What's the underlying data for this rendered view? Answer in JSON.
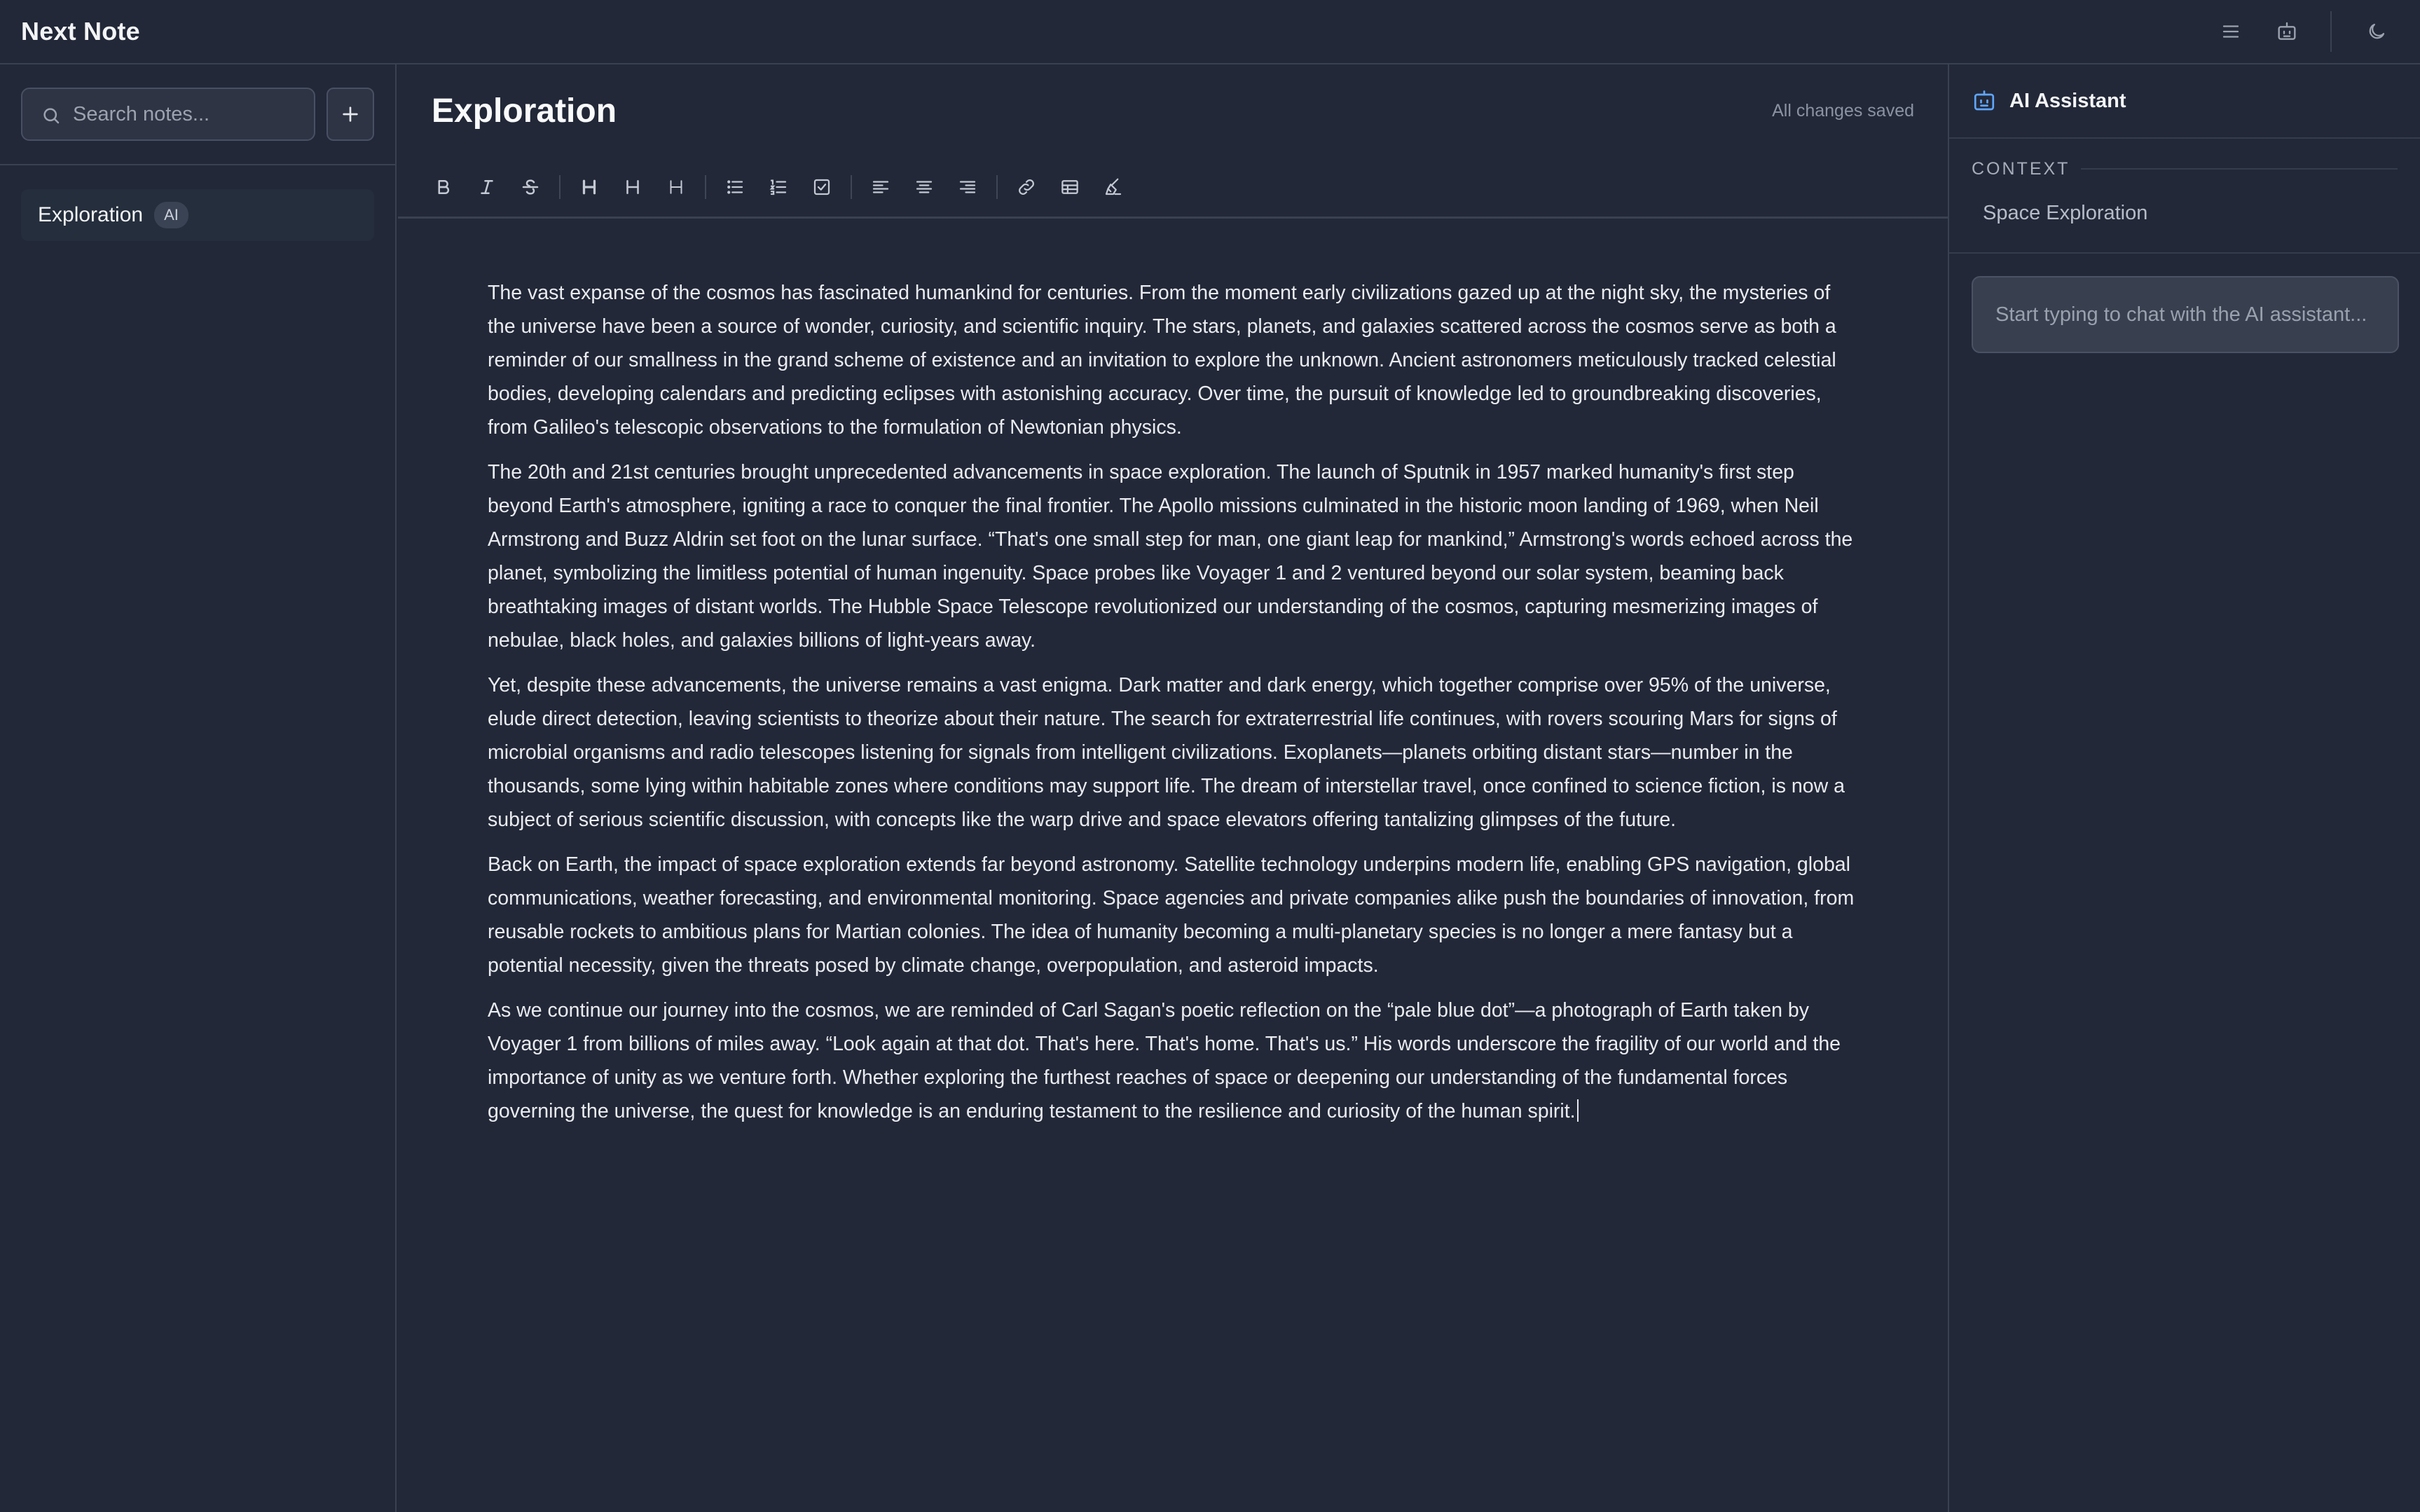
{
  "app": {
    "title": "Next Note"
  },
  "topbar": {
    "icons": [
      "menu-icon",
      "bot-icon",
      "moon-icon"
    ]
  },
  "sidebar": {
    "search_placeholder": "Search notes...",
    "notes": [
      {
        "title": "Exploration",
        "badge": "AI"
      }
    ]
  },
  "editor": {
    "title": "Exploration",
    "save_status": "All changes saved",
    "toolbar": {
      "heading_glyph": "H"
    },
    "paragraphs": [
      "The vast expanse of the cosmos has fascinated humankind for centuries. From the moment early civilizations gazed up at the night sky, the mysteries of the universe have been a source of wonder, curiosity, and scientific inquiry. The stars, planets, and galaxies scattered across the cosmos serve as both a reminder of our smallness in the grand scheme of existence and an invitation to explore the unknown. Ancient astronomers meticulously tracked celestial bodies, developing calendars and predicting eclipses with astonishing accuracy. Over time, the pursuit of knowledge led to groundbreaking discoveries, from Galileo's telescopic observations to the formulation of Newtonian physics.",
      "The 20th and 21st centuries brought unprecedented advancements in space exploration. The launch of Sputnik in 1957 marked humanity's first step beyond Earth's atmosphere, igniting a race to conquer the final frontier. The Apollo missions culminated in the historic moon landing of 1969, when Neil Armstrong and Buzz Aldrin set foot on the lunar surface. “That's one small step for man, one giant leap for mankind,” Armstrong's words echoed across the planet, symbolizing the limitless potential of human ingenuity. Space probes like Voyager 1 and 2 ventured beyond our solar system, beaming back breathtaking images of distant worlds. The Hubble Space Telescope revolutionized our understanding of the cosmos, capturing mesmerizing images of nebulae, black holes, and galaxies billions of light-years away.",
      "Yet, despite these advancements, the universe remains a vast enigma. Dark matter and dark energy, which together comprise over 95% of the universe, elude direct detection, leaving scientists to theorize about their nature. The search for extraterrestrial life continues, with rovers scouring Mars for signs of microbial organisms and radio telescopes listening for signals from intelligent civilizations. Exoplanets—planets orbiting distant stars—number in the thousands, some lying within habitable zones where conditions may support life. The dream of interstellar travel, once confined to science fiction, is now a subject of serious scientific discussion, with concepts like the warp drive and space elevators offering tantalizing glimpses of the future.",
      "Back on Earth, the impact of space exploration extends far beyond astronomy. Satellite technology underpins modern life, enabling GPS navigation, global communications, weather forecasting, and environmental monitoring. Space agencies and private companies alike push the boundaries of innovation, from reusable rockets to ambitious plans for Martian colonies. The idea of humanity becoming a multi-planetary species is no longer a mere fantasy but a potential necessity, given the threats posed by climate change, overpopulation, and asteroid impacts.",
      "As we continue our journey into the cosmos, we are reminded of Carl Sagan's poetic reflection on the “pale blue dot”—a photograph of Earth taken by Voyager 1 from billions of miles away. “Look again at that dot. That's here. That's home. That's us.” His words underscore the fragility of our world and the importance of unity as we venture forth. Whether exploring the furthest reaches of space or deepening our understanding of the fundamental forces governing the universe, the quest for knowledge is an enduring testament to the resilience and curiosity of the human spirit."
    ]
  },
  "assistant": {
    "title": "AI Assistant",
    "context_label": "CONTEXT",
    "context_value": "Space Exploration",
    "chat_placeholder": "Start typing to chat with the AI assistant..."
  }
}
